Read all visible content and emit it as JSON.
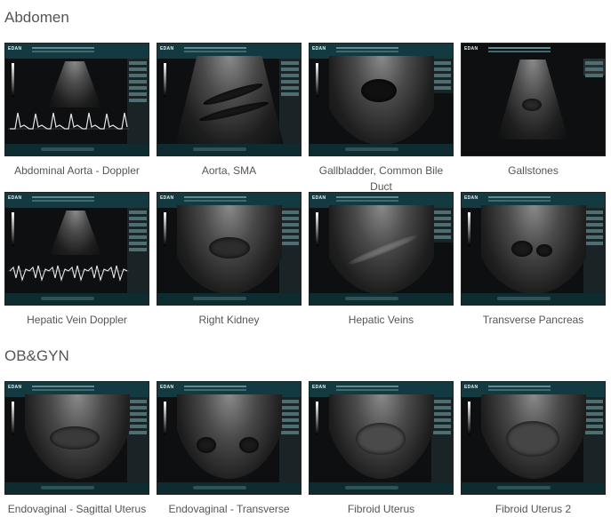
{
  "sections": [
    {
      "title": "Abdomen",
      "items": [
        {
          "caption": "Abdominal Aorta - Doppler"
        },
        {
          "caption": "Aorta, SMA"
        },
        {
          "caption": "Gallbladder, Common Bile Duct"
        },
        {
          "caption": "Gallstones"
        },
        {
          "caption": "Hepatic Vein Doppler"
        },
        {
          "caption": "Right Kidney"
        },
        {
          "caption": "Hepatic Veins"
        },
        {
          "caption": "Transverse Pancreas"
        }
      ]
    },
    {
      "title": "OB&GYN",
      "items": [
        {
          "caption": "Endovaginal - Sagittal Uterus"
        },
        {
          "caption": "Endovaginal - Transverse"
        },
        {
          "caption": "Fibroid Uterus"
        },
        {
          "caption": "Fibroid Uterus 2"
        }
      ]
    }
  ],
  "logo_text": "EDAN",
  "colors": {
    "caption": "#555555",
    "heading": "#555555",
    "thumb_bg": "#0d0f10",
    "ui_bar": "#123a40"
  }
}
